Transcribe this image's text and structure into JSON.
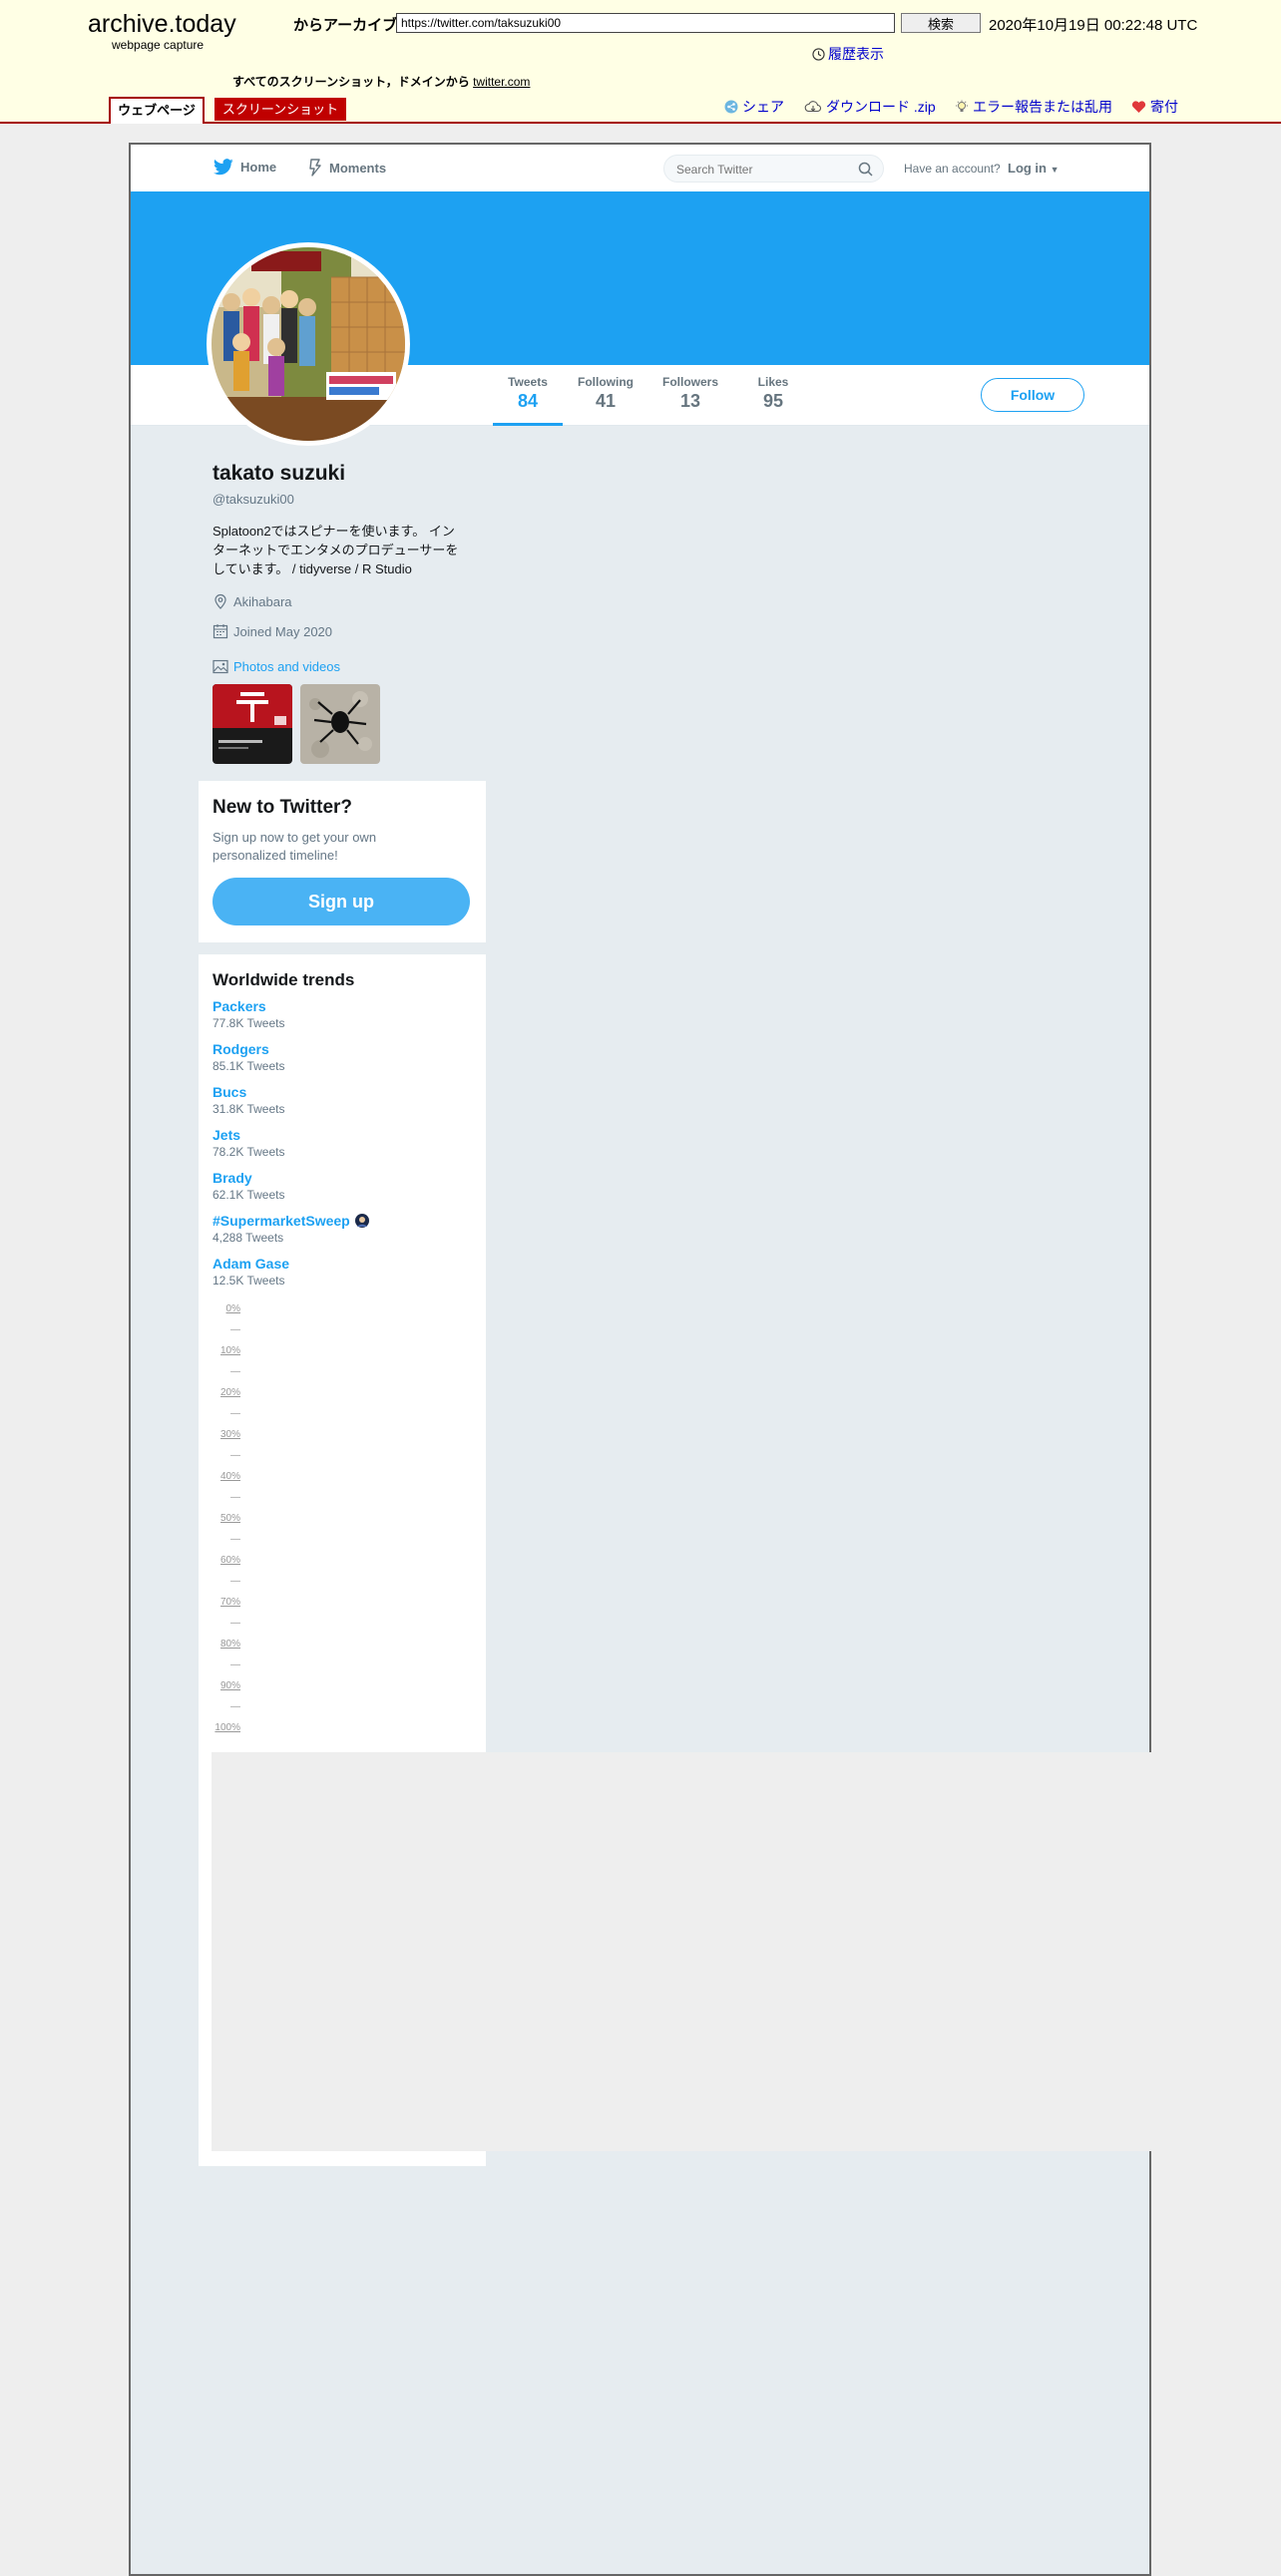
{
  "archive": {
    "logo": "archive.today",
    "subtitle": "webpage capture",
    "from_label": "からアーカイブ",
    "url_value": "https://twitter.com/taksuzuki00",
    "search_button": "検索",
    "capture_date": "2020年10月19日 00:22:48 UTC",
    "history_link": "履歴表示",
    "all_screenshots_text": "すべてのスクリーンショット，ドメインから",
    "domain_link": "twitter.com",
    "tabs": {
      "webpage": "ウェブページ",
      "screenshot": "スクリーンショット"
    },
    "actions": {
      "share": "シェア",
      "download": "ダウンロード .zip",
      "report": "エラー報告または乱用",
      "donate": "寄付"
    }
  },
  "twitter": {
    "nav": {
      "home": "Home",
      "moments": "Moments",
      "search_placeholder": "Search Twitter",
      "have_account": "Have an account?",
      "login": "Log in"
    },
    "stats": {
      "tweets_label": "Tweets",
      "tweets_value": "84",
      "following_label": "Following",
      "following_value": "41",
      "followers_label": "Followers",
      "followers_value": "13",
      "likes_label": "Likes",
      "likes_value": "95"
    },
    "follow_button": "Follow",
    "profile": {
      "name": "takato suzuki",
      "handle": "@taksuzuki00",
      "bio": "Splatoon2ではスピナーを使います。 インターネットでエンタメのプロデューサーをしています。 / tidyverse / R Studio",
      "location": "Akihabara",
      "joined": "Joined May 2020",
      "photos_link": "Photos and videos"
    },
    "signup": {
      "title": "New to Twitter?",
      "text": "Sign up now to get your own personalized timeline!",
      "button": "Sign up"
    },
    "trends": {
      "title": "Worldwide trends",
      "items": [
        {
          "name": "Packers",
          "count": "77.8K Tweets"
        },
        {
          "name": "Rodgers",
          "count": "85.1K Tweets"
        },
        {
          "name": "Bucs",
          "count": "31.8K Tweets"
        },
        {
          "name": "Jets",
          "count": "78.2K Tweets"
        },
        {
          "name": "Brady",
          "count": "62.1K Tweets"
        },
        {
          "name": "#SupermarketSweep",
          "count": "4,288 Tweets"
        },
        {
          "name": "Adam Gase",
          "count": "12.5K Tweets"
        }
      ]
    },
    "scale": [
      "0%",
      "10%",
      "20%",
      "30%",
      "40%",
      "50%",
      "60%",
      "70%",
      "80%",
      "90%",
      "100%"
    ],
    "colors": {
      "brand": "#1da1f2",
      "archive_red": "#a50000"
    }
  }
}
